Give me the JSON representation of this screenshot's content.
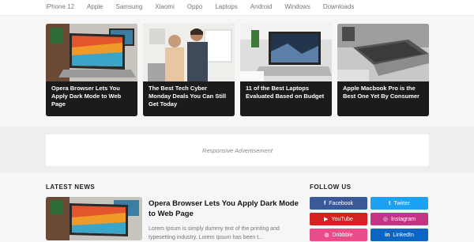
{
  "nav": {
    "items": [
      "iPhone 12",
      "Apple",
      "Samsung",
      "Xiaomi",
      "Oppo",
      "Laptops",
      "Android",
      "Windows",
      "Downloads"
    ]
  },
  "featured": [
    {
      "title": "Opera Browser Lets You Apply Dark Mode to Web Page"
    },
    {
      "title": "The Best Tech Cyber Monday Deals You Can Still Get Today"
    },
    {
      "title": "11 of the Best Laptops Evaluated Based on Budget"
    },
    {
      "title": "Apple Macbook Pro is the Best One Yet By Consumer"
    }
  ],
  "ad": {
    "label": "Responsive Advertisement"
  },
  "latest": {
    "heading": "LATEST NEWS",
    "post": {
      "title": "Opera Browser Lets You Apply Dark Mode to Web Page",
      "excerpt": "Lorem Ipsum is simply dummy text of the printing and typesetting industry. Lorem Ipsum has been t..."
    }
  },
  "follow": {
    "heading": "FOLLOW US",
    "items": [
      {
        "label": "Facebook",
        "icon": "facebook-icon",
        "glyph": "f",
        "color": "#3b5998"
      },
      {
        "label": "Twitter",
        "icon": "twitter-icon",
        "glyph": "t",
        "color": "#1da1f2"
      },
      {
        "label": "YouTube",
        "icon": "youtube-icon",
        "glyph": "▶",
        "color": "#d22222"
      },
      {
        "label": "Instagram",
        "icon": "instagram-icon",
        "glyph": "◎",
        "color": "#c13584"
      },
      {
        "label": "Dribbble",
        "icon": "dribbble-icon",
        "glyph": "◍",
        "color": "#ea4c89"
      },
      {
        "label": "LinkedIn",
        "icon": "linkedin-icon",
        "glyph": "in",
        "color": "#0a66c2"
      }
    ]
  }
}
